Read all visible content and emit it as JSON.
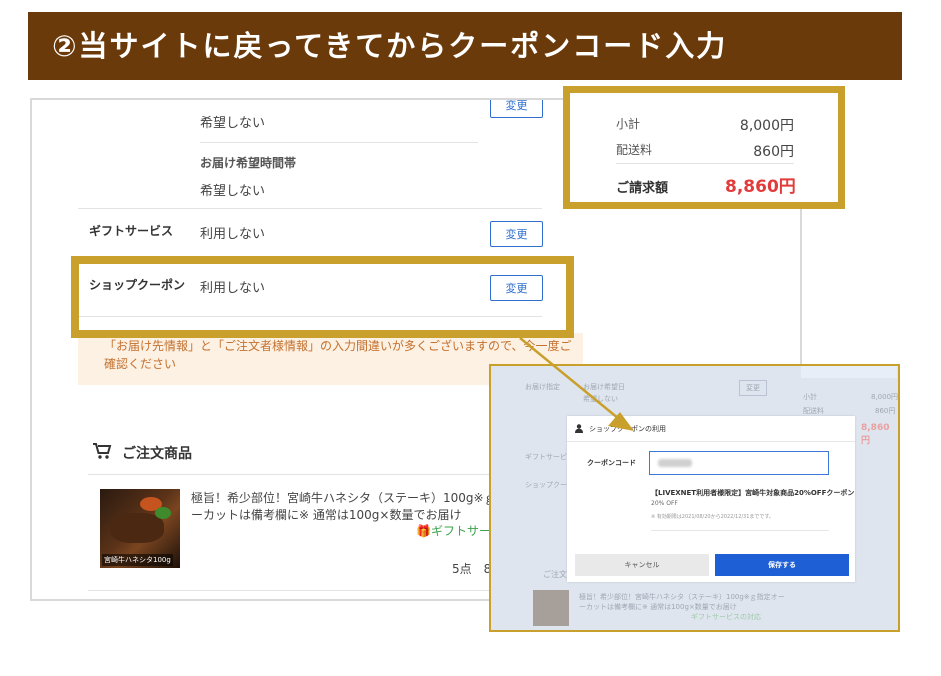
{
  "banner": {
    "title": "②当サイトに戻ってきてからクーポンコード入力"
  },
  "main": {
    "delivery_top_value": "希望しない",
    "delivery_time_label": "お届け希望時間帯",
    "delivery_time_value": "希望しない",
    "gift_label": "ギフトサービス",
    "gift_value": "利用しない",
    "coupon_label": "ショップクーポン",
    "coupon_value": "利用しない",
    "change_label": "変更",
    "warning": "「お届け先情報」と「ご注文者様情報」の入力間違いが多くございますので、今一度ご確認ください",
    "order_title": "ご注文商品",
    "product": {
      "name_line1": "極旨！希少部位！宮崎牛ハネシタ（ステーキ）100g※ｇ指定オ",
      "name_line2": "ーカットは備考欄に※ 通常は100g×数量でお届け",
      "gift_link": "ギフトサービ",
      "qty_price": "5点　8,0",
      "image_caption": "宮崎牛ハネシタ100g"
    }
  },
  "summary": {
    "subtotal_label": "小計",
    "subtotal_value": "8,000円",
    "shipping_label": "配送料",
    "shipping_value": "860円",
    "total_label": "ご請求額",
    "total_value": "8,860円"
  },
  "modal": {
    "bg": {
      "delivery_label": "お届け指定",
      "delivery_time": "お届け希望日",
      "delivery_value": "希望しない",
      "change": "変更",
      "subtotal_label": "小計",
      "subtotal_value": "8,000円",
      "shipping_label": "配送料",
      "shipping_value": "860円",
      "total_value": "8,860円",
      "gift_label": "ギフトサービス",
      "coupon_label": "ショップクーポン",
      "order_title": "ご注文商品",
      "product_line1": "極旨！希少部位！宮崎牛ハネシタ（ステーキ）100g※ｇ指定オー",
      "product_line2": "ーカットは備考欄に※ 通常は100g×数量でお届け",
      "gift_link": "ギフトサービスの対応"
    },
    "dialog": {
      "title": "ショップクーポンの利用",
      "code_label": "クーポンコード",
      "coupon_name": "【LIVEXNET利用者様限定】宮崎牛対象商品20%OFFクーポン",
      "coupon_off": "20% OFF",
      "coupon_period": "※ 有効期限は2021/08/20から2022/12/31までです。",
      "cancel": "キャンセル",
      "save": "保存する"
    }
  },
  "colors": {
    "banner": "#6b3a0b",
    "highlight": "#c9a02c",
    "link_blue": "#2f6fce",
    "total_red": "#e23b3b",
    "save_blue": "#1f5fd6"
  }
}
